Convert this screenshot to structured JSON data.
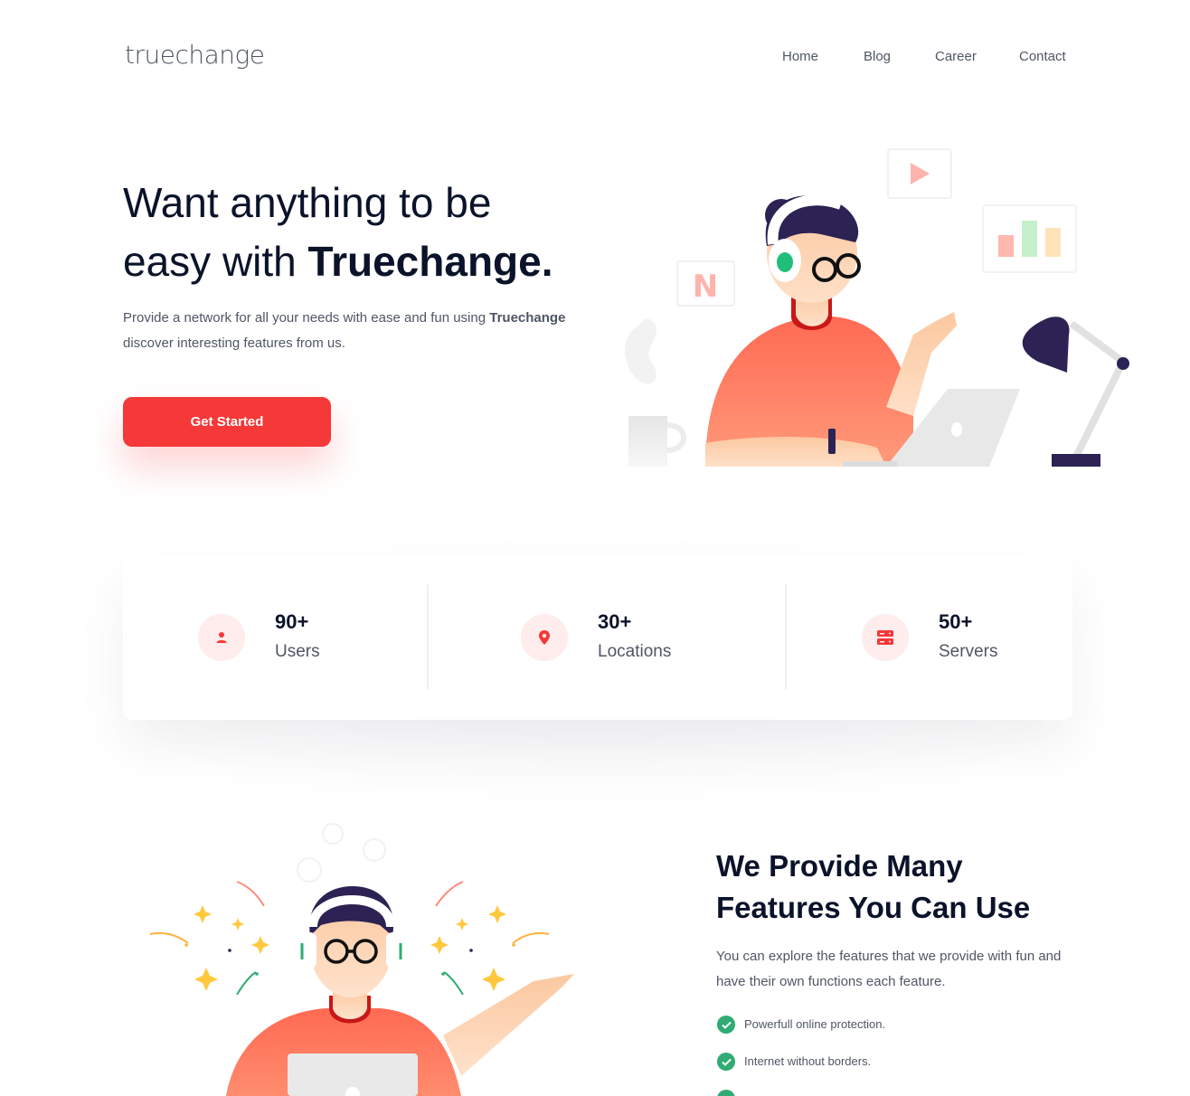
{
  "header": {
    "logo": "truechange",
    "nav": [
      "Home",
      "Blog",
      "Career",
      "Contact"
    ]
  },
  "hero": {
    "title_line1": "Want anything to be",
    "title_line2_prefix": "easy with ",
    "title_line2_brand": "Truechange.",
    "desc_prefix": "Provide a network for all your needs with ease and fun using ",
    "desc_brand": "Truechange",
    "desc_suffix": "discover interesting features from us.",
    "cta_label": "Get Started",
    "illustration_sign": "N"
  },
  "stats": [
    {
      "value": "90+",
      "label": "Users",
      "icon": "user-icon"
    },
    {
      "value": "30+",
      "label": "Locations",
      "icon": "location-pin-icon"
    },
    {
      "value": "50+",
      "label": "Servers",
      "icon": "server-icon"
    }
  ],
  "features": {
    "title_line1": "We Provide Many",
    "title_line2": "Features You Can Use",
    "desc": "You can explore the features that we provide with fun and have their own functions each feature.",
    "items": [
      "Powerfull online protection.",
      "Internet without borders."
    ]
  },
  "colors": {
    "accent": "#f53838",
    "accent_soft": "#ffecec",
    "check": "#2fab73",
    "heading": "#0b132a",
    "body_text": "#4f5665"
  }
}
